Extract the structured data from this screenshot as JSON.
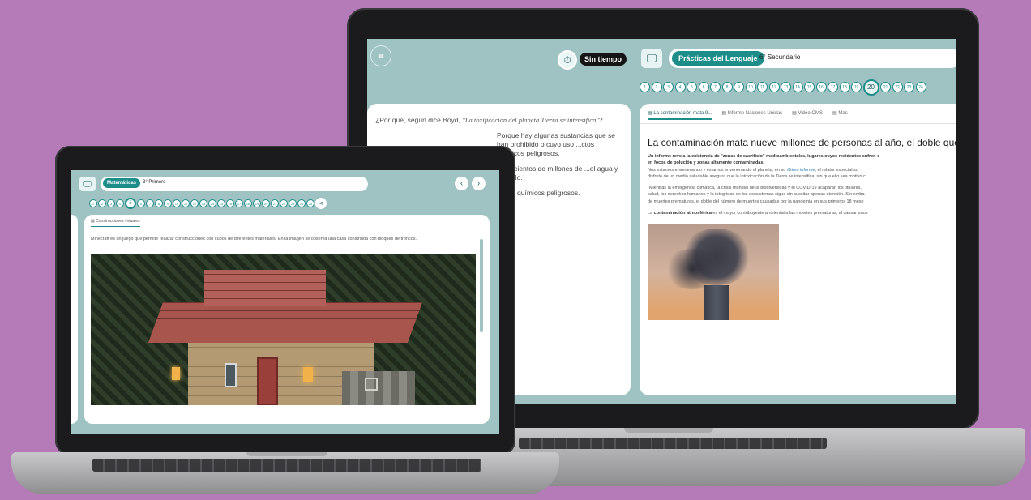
{
  "big": {
    "timer_label": "Sin tiempo",
    "subject": "Prácticas del Lenguaje",
    "grade": "6° Secundario",
    "question_numbers": [
      "1",
      "2",
      "3",
      "4",
      "5",
      "6",
      "7",
      "8",
      "9",
      "10",
      "11",
      "12",
      "13",
      "14",
      "15",
      "16",
      "17",
      "18",
      "19",
      "20",
      "21",
      "22",
      "23",
      "24"
    ],
    "current_question": "20",
    "question_prefix": "¿Por qué, según dice Boyd, ",
    "question_quote": "\"La toxificación del planeta Tierra se intensifica\"",
    "question_suffix": "?",
    "options": [
      "Porque hay algunas sustancias que se han prohibido o cuyo uso ...ctos químicos peligrosos.",
      "...ten cientos de millones de ...el agua y el suelo.",
      "...ctos químicos peligrosos."
    ],
    "tabs": [
      "La contaminación mata 9...",
      "Informe Naciones Unidas",
      "Video OMS",
      "Mas"
    ],
    "article": {
      "title": "La contaminación mata nueve millones de personas al año, el doble que el",
      "p1": "Un informe revela la existencia de \"zonas de sacrificio\" medioambientales, lugares cuyos residentes sufren c",
      "p1b": "en focos de polución y zonas altamente contaminadas.",
      "p2_a": "Nos estamos envenenando y estamos envenenando el planeta, en su ",
      "p2_link": "último informe",
      "p2_b": ", el relator especial so",
      "p2c": "disfrute de un medio saludable asegura que la intoxicación de la Tierra se intensifica, sin que ello sea motivo c",
      "p3": "\"Mientras la emergencia climática, la crisis mundial de la biodiversidad y el COVID-19 acaparan los titulares,",
      "p3b": "salud, los derechos humanos y la integridad de los ecosistemas sigue sin suscitar apenas atención. Sin emba",
      "p3c": "de muertes prematuras, el doble del número de muertes causadas por la pandemia en sus primeros 18 mese",
      "p4_bold": "contaminación atmosférica",
      "p4_a": "La ",
      "p4_b": " es el mayor contribuyente ambiental a las muertes prematuras, al causar unos"
    }
  },
  "small": {
    "subject": "Matemáticas",
    "grade": "3° Primero",
    "question_numbers": [
      "1",
      "2",
      "3",
      "4",
      "5",
      "6",
      "7",
      "8",
      "9",
      "10",
      "11",
      "12",
      "13",
      "14",
      "15",
      "16",
      "17",
      "18",
      "19",
      "20",
      "21",
      "22",
      "23",
      "24",
      "25"
    ],
    "current_question": "5",
    "tab": "Construcciones virtuales",
    "description": "Minecraft es un juego que permite realizar construcciones con cubos de diferentes materiales. En la imagen se observa una casa construida con bloques de troncos."
  }
}
